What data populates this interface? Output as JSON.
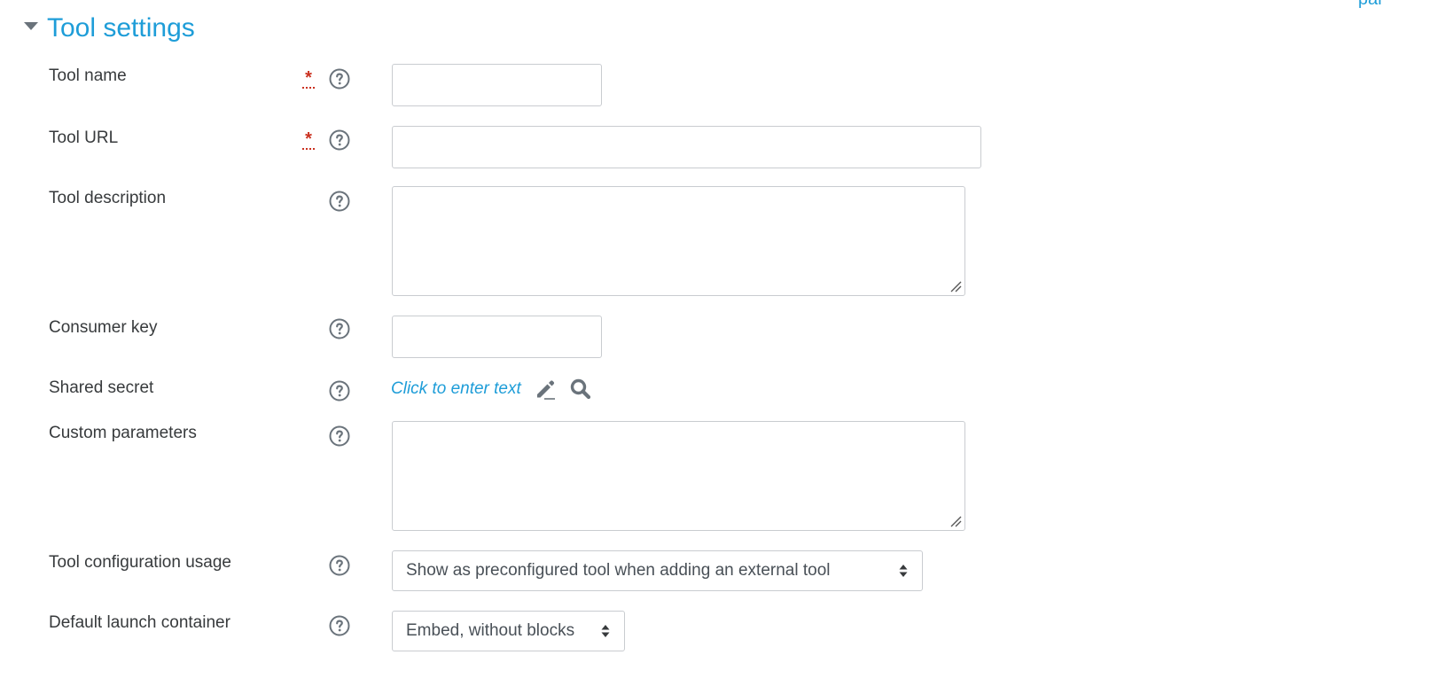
{
  "header": {
    "corner_link_text": "par",
    "section_title": "Tool settings"
  },
  "fields": {
    "tool_name": {
      "label": "Tool name",
      "required": true,
      "value": ""
    },
    "tool_url": {
      "label": "Tool URL",
      "required": true,
      "value": ""
    },
    "tool_description": {
      "label": "Tool description",
      "value": ""
    },
    "consumer_key": {
      "label": "Consumer key",
      "value": ""
    },
    "shared_secret": {
      "label": "Shared secret",
      "link_text": "Click to enter text"
    },
    "custom_parameters": {
      "label": "Custom parameters",
      "value": ""
    },
    "tool_config_usage": {
      "label": "Tool configuration usage",
      "selected": "Show as preconfigured tool when adding an external tool"
    },
    "default_launch_container": {
      "label": "Default launch container",
      "selected": "Embed, without blocks"
    }
  },
  "icons": {
    "required": "required-asterisk-icon",
    "help": "question-circle-icon",
    "edit": "pencil-icon",
    "reveal": "magnifier-icon",
    "collapse": "caret-down-icon",
    "select_arrows": "sort-arrows-icon"
  },
  "colors": {
    "link": "#1e9dd8",
    "required": "#ca3120",
    "icon": "#6a737b",
    "border": "#c9ccd0",
    "text": "#373a3c"
  }
}
